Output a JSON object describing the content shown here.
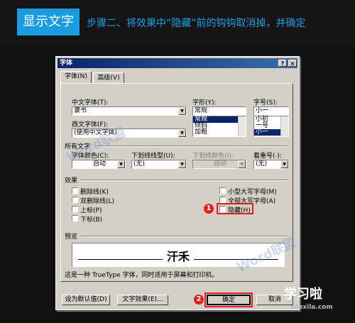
{
  "banner": {
    "tag": "显示文字",
    "instruction": "步骤二、将效果中“隐藏”前的钩钩取消掉，并确定"
  },
  "dialog": {
    "title": "字体",
    "help": "?",
    "close": "×",
    "tabs": [
      "字体(N)",
      "高级(V)"
    ],
    "chinese_font": {
      "label": "中文字体(T):",
      "value": "隶书"
    },
    "western_font": {
      "label": "西文字体(F):",
      "value": "(使用中文字体)"
    },
    "font_style": {
      "label": "字形(Y):",
      "value": "常规",
      "options": [
        "常规",
        "倾斜",
        "加粗"
      ]
    },
    "font_size": {
      "label": "字号(S):",
      "value": "小一",
      "options": [
        "小初",
        "一号",
        "小一"
      ]
    },
    "all_text": {
      "header": "所有文字",
      "font_color": {
        "label": "字体颜色(C):",
        "value": "自动"
      },
      "underline_style": {
        "label": "下划线线型(U):",
        "value": "(无)"
      },
      "underline_color": {
        "label": "下划线颜色(I):",
        "value": "自动"
      },
      "emphasis": {
        "label": "着重号(·):",
        "value": "(无)"
      }
    },
    "effects": {
      "header": "效果",
      "items": [
        "删除线(K)",
        "双删除线(L)",
        "上标(P)",
        "下标(B)",
        "小型大写字母(M)",
        "全部大写字母(A)",
        "隐藏(H)"
      ]
    },
    "preview": {
      "header": "预览",
      "sample": "汗禾",
      "note": "这是一种 TrueType 字体，同时适用于屏幕和打印机。"
    },
    "buttons": {
      "default": "设为默认值(D)",
      "text_effects": "文字效果(E)...",
      "ok": "确定",
      "cancel": "取消"
    }
  },
  "markers": [
    "1",
    "2"
  ],
  "watermarks": {
    "word": "Word联盟",
    "logo": "学习啦",
    "url": "xdexila.com"
  }
}
